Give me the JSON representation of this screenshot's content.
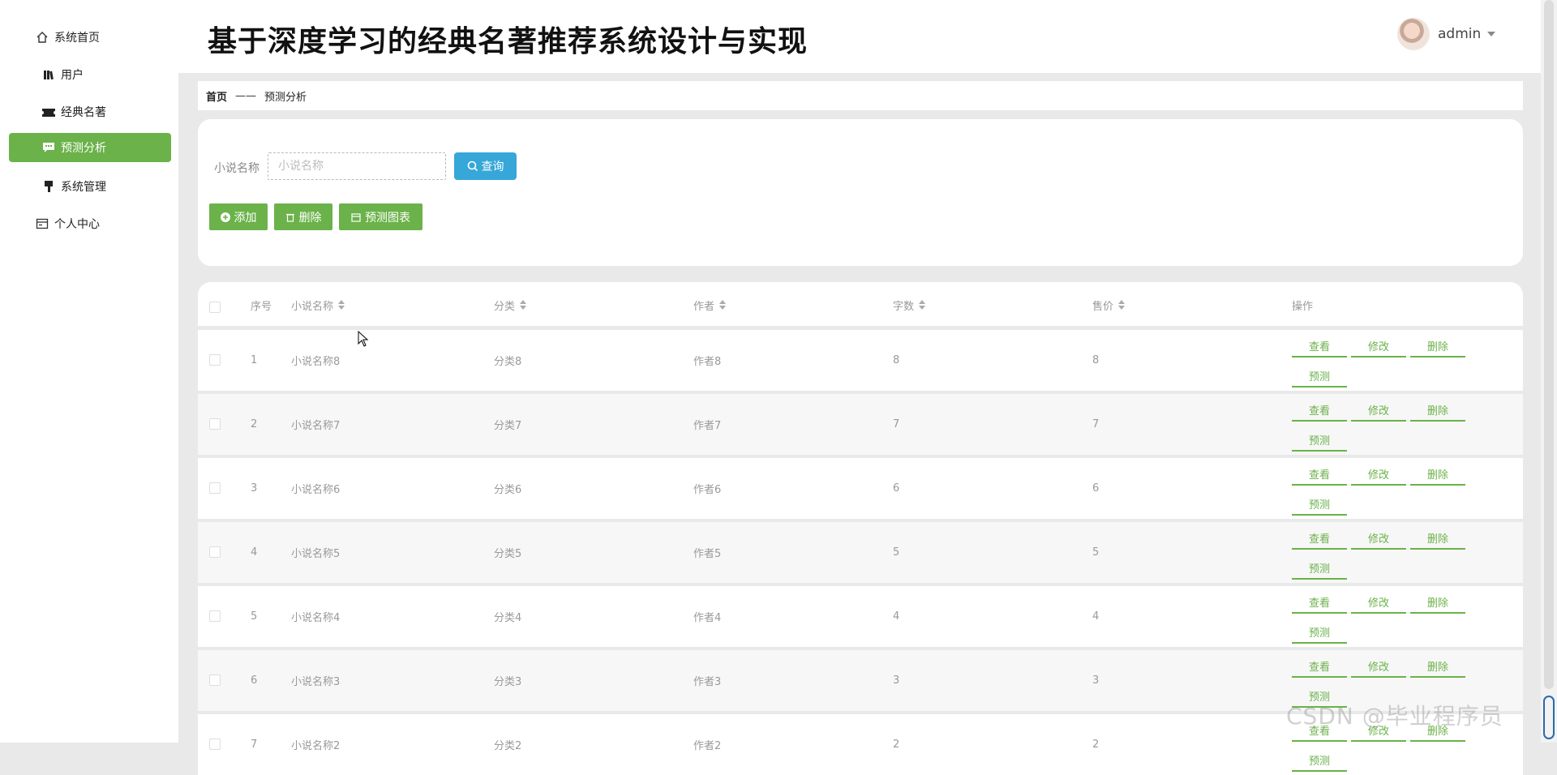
{
  "sidebar": {
    "items": [
      {
        "label": "系统首页",
        "icon": "home-icon"
      },
      {
        "label": "用户",
        "icon": "books-icon"
      },
      {
        "label": "经典名著",
        "icon": "ticket-icon"
      },
      {
        "label": "预测分析",
        "icon": "chat-icon",
        "active": true
      },
      {
        "label": "系统管理",
        "icon": "brush-icon"
      },
      {
        "label": "个人中心",
        "icon": "card-icon"
      }
    ]
  },
  "header": {
    "title": "基于深度学习的经典名著推荐系统设计与实现",
    "username": "admin"
  },
  "breadcrumb": {
    "home": "首页",
    "separator": "——",
    "current": "预测分析"
  },
  "search": {
    "label": "小说名称",
    "placeholder": "小说名称",
    "query_label": "查询"
  },
  "actions": {
    "add": "添加",
    "delete": "删除",
    "chart": "预测图表"
  },
  "table": {
    "headers": {
      "index": "序号",
      "name": "小说名称",
      "category": "分类",
      "author": "作者",
      "words": "字数",
      "price": "售价",
      "ops": "操作"
    },
    "op_labels": {
      "view": "查看",
      "edit": "修改",
      "delete": "删除",
      "predict": "预测"
    },
    "rows": [
      {
        "index": "1",
        "name": "小说名称8",
        "category": "分类8",
        "author": "作者8",
        "words": "8",
        "price": "8"
      },
      {
        "index": "2",
        "name": "小说名称7",
        "category": "分类7",
        "author": "作者7",
        "words": "7",
        "price": "7"
      },
      {
        "index": "3",
        "name": "小说名称6",
        "category": "分类6",
        "author": "作者6",
        "words": "6",
        "price": "6"
      },
      {
        "index": "4",
        "name": "小说名称5",
        "category": "分类5",
        "author": "作者5",
        "words": "5",
        "price": "5"
      },
      {
        "index": "5",
        "name": "小说名称4",
        "category": "分类4",
        "author": "作者4",
        "words": "4",
        "price": "4"
      },
      {
        "index": "6",
        "name": "小说名称3",
        "category": "分类3",
        "author": "作者3",
        "words": "3",
        "price": "3"
      },
      {
        "index": "7",
        "name": "小说名称2",
        "category": "分类2",
        "author": "作者2",
        "words": "2",
        "price": "2"
      }
    ]
  },
  "watermark": "CSDN @毕业程序员",
  "colors": {
    "accent_green": "#6bb24a",
    "query_blue": "#36a7d8",
    "background": "#e9e9e9"
  }
}
